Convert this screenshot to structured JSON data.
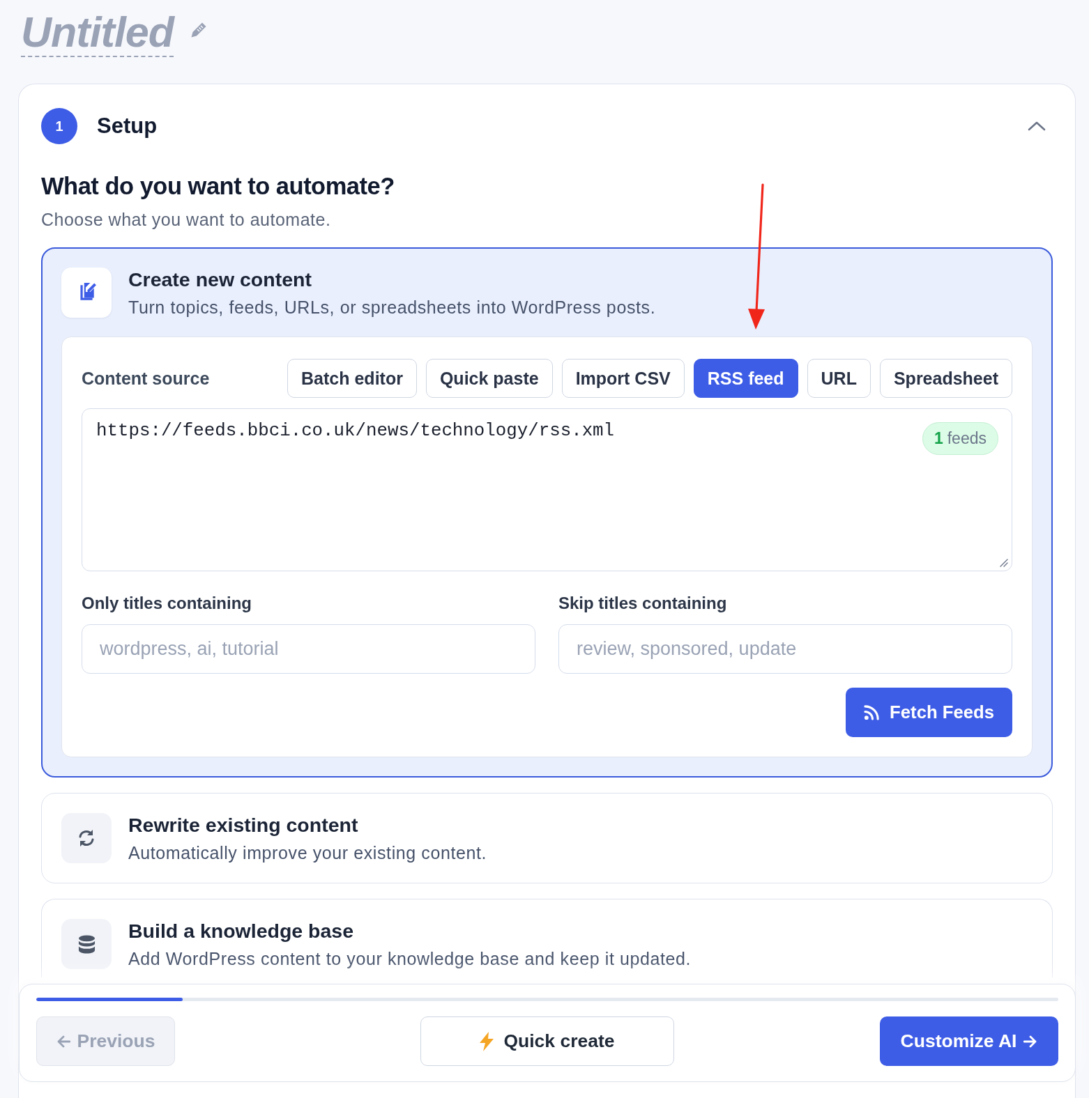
{
  "document": {
    "title": "Untitled"
  },
  "step": {
    "number": "1",
    "title": "Setup",
    "expanded": true
  },
  "section": {
    "heading": "What do you want to automate?",
    "subheading": "Choose what you want to automate."
  },
  "options": [
    {
      "kind": "create",
      "title": "Create new content",
      "description": "Turn topics, feeds, URLs, or spreadsheets into WordPress posts.",
      "selected": true,
      "source_panel": {
        "label": "Content source",
        "tabs": [
          {
            "label": "Batch editor",
            "selected": false
          },
          {
            "label": "Quick paste",
            "selected": false
          },
          {
            "label": "Import CSV",
            "selected": false
          },
          {
            "label": "RSS feed",
            "selected": true
          },
          {
            "label": "URL",
            "selected": false
          },
          {
            "label": "Spreadsheet",
            "selected": false
          }
        ],
        "feeds_value": "https://feeds.bbci.co.uk/news/technology/rss.xml",
        "feed_count": "**1** feeds",
        "filters": [
          {
            "label": "Only titles containing",
            "placeholder": "wordpress, ai, tutorial"
          },
          {
            "label": "Skip titles containing",
            "placeholder": "review, sponsored, update"
          }
        ],
        "action_button": "Fetch Feeds"
      }
    },
    {
      "kind": "rewrite",
      "title": "Rewrite existing content",
      "description": "Automatically improve your existing content.",
      "selected": false
    },
    {
      "kind": "knowledge",
      "title": "Build a knowledge base",
      "description": "Add WordPress content to your knowledge base and keep it updated.",
      "selected": false
    }
  ],
  "footer": {
    "progress": {
      "level": 0.143
    },
    "buttons": [
      {
        "kind": "previous",
        "label": "Previous",
        "disabled": true
      },
      {
        "kind": "quick",
        "label": "Quick create",
        "disabled": false
      },
      {
        "kind": "next",
        "label": "Customize AI",
        "disabled": false
      }
    ]
  }
}
